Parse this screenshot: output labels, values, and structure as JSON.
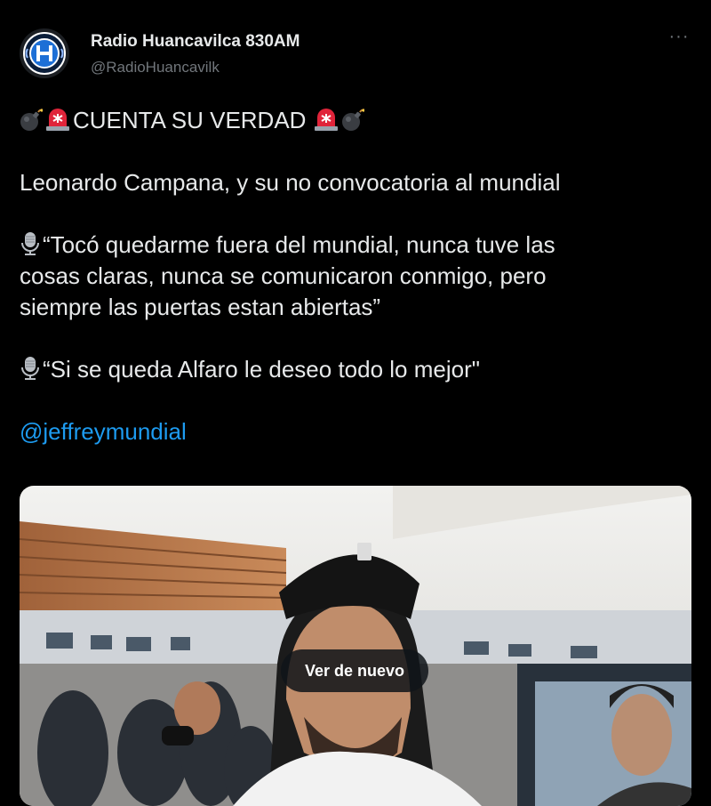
{
  "account": {
    "display_name": "Radio Huancavilca 830AM",
    "handle": "@RadioHuancavilk",
    "avatar_letter": "H",
    "avatar_color": "#1d6fd6"
  },
  "menu": {
    "more_label": "···"
  },
  "tweet": {
    "headline": "CUENTA SU VERDAD",
    "line1": "Leonardo Campana, y su no convocatoria al mundial",
    "quote1_l1": "“Tocó quedarme fuera del mundial, nunca tuve las",
    "quote1_l2": "cosas claras, nunca se comunicaron conmigo, pero",
    "quote1_l3": "siempre las puertas estan abiertas”",
    "quote2": "“Si se queda Alfaro le deseo todo lo mejor\"",
    "mention": "@jeffreymundial"
  },
  "media": {
    "replay_label": "Ver de nuevo"
  },
  "colors": {
    "link": "#1d9bf0",
    "background": "#000000",
    "text": "#e7e9ea",
    "muted": "#71767b"
  }
}
